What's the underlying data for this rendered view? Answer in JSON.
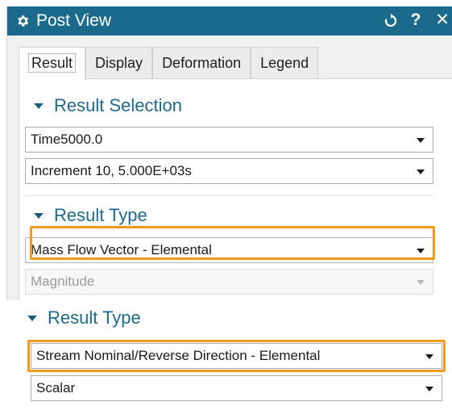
{
  "colors": {
    "titlebar": "#1b6a8c",
    "section_header": "#1b6a8c",
    "highlight": "#f39a1c"
  },
  "titlebar": {
    "icon": "gear-icon",
    "title": "Post View",
    "reset_icon": "reset-icon",
    "help_label": "?",
    "close_label": "✕"
  },
  "tabs": [
    {
      "label": "Result",
      "active": true
    },
    {
      "label": "Display",
      "active": false
    },
    {
      "label": "Deformation",
      "active": false
    },
    {
      "label": "Legend",
      "active": false
    }
  ],
  "result_selection": {
    "header": "Result Selection",
    "time_value": "Time5000.0",
    "increment_value": "Increment 10, 5.000E+03s"
  },
  "result_type": {
    "header": "Result Type",
    "type_value": "Mass Flow Vector - Elemental",
    "component_value": "Magnitude",
    "component_disabled": true
  },
  "result_type_alt": {
    "header": "Result Type",
    "type_value": "Stream Nominal/Reverse Direction - Elemental",
    "component_value": "Scalar"
  }
}
